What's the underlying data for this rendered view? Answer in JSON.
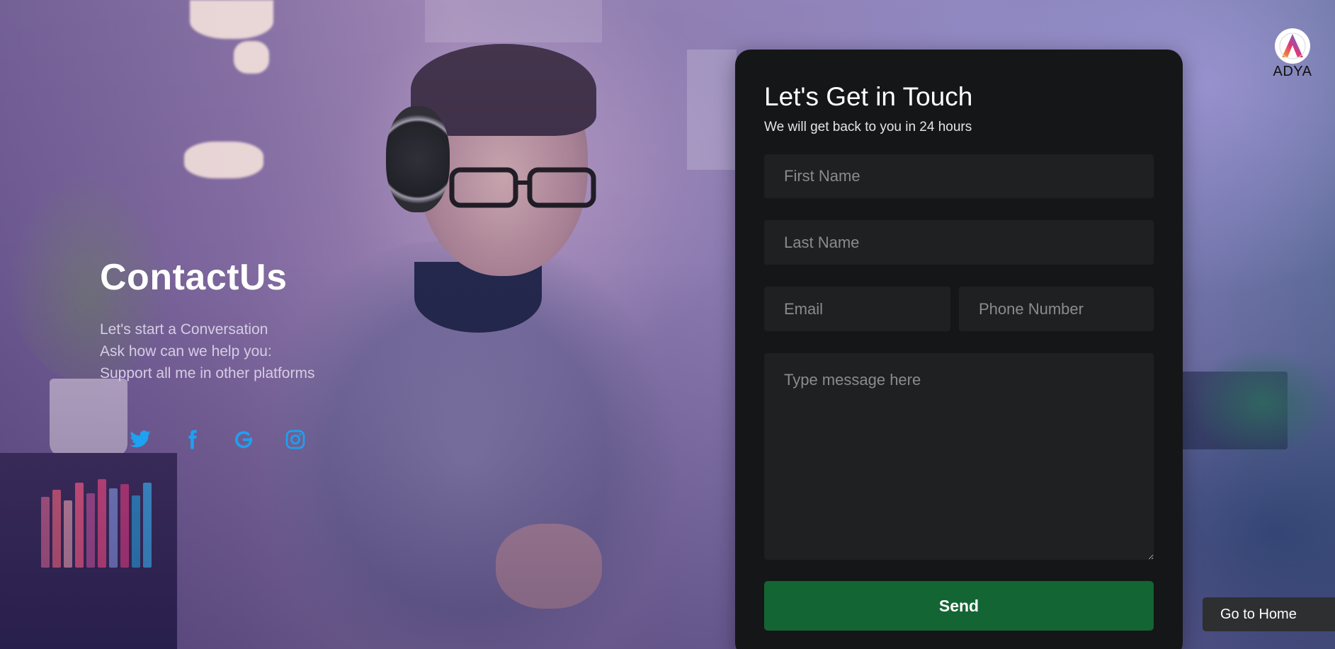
{
  "hero": {
    "title": "ContactUs",
    "lines": [
      "Let's start a Conversation",
      "Ask how can we help you:",
      "Support all me in other platforms"
    ]
  },
  "socials": [
    {
      "icon": "twitter-icon",
      "color": "#1da1f2"
    },
    {
      "icon": "facebook-icon",
      "color": "#1da1f2"
    },
    {
      "icon": "google-icon",
      "color": "#1da1f2"
    },
    {
      "icon": "instagram-icon",
      "color": "#1da1f2"
    }
  ],
  "form": {
    "title": "Let's Get in Touch",
    "subtitle": "We will get back to you in 24 hours",
    "first_name_placeholder": "First Name",
    "last_name_placeholder": "Last Name",
    "email_placeholder": "Email",
    "phone_placeholder": "Phone Number",
    "message_placeholder": "Type message here",
    "send_label": "Send",
    "send_color": "#146534"
  },
  "logo": {
    "text": "ADYA"
  },
  "go_home_label": "Go to Home"
}
